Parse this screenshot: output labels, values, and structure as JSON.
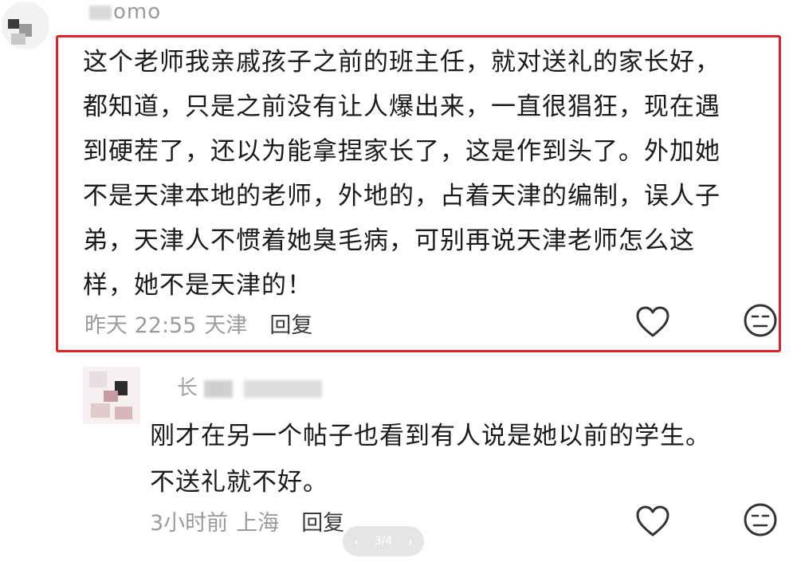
{
  "top_comment": {
    "username_visible": "omo",
    "lines": [
      "这个老师我亲戚孩子之前的班主任，就对送礼的家长好，",
      "都知道，只是之前没有让人爆出来，一直很猖狂，现在遇",
      "到硬茬了，还以为能拿捏家长了，这是作到头了。外加她",
      "不是天津本地的老师，外地的，占着天津的编制，误人子",
      "弟，天津人不惯着她臭毛病，可别再说天津老师怎么这",
      "样，她不是天津的！"
    ],
    "time": "昨天 22:55",
    "location": "天津",
    "reply_label": "回复",
    "like_icon": "heart-outline-icon",
    "emoji_icon": "meh-face-icon",
    "highlight_color": "#e0232a"
  },
  "reply_comment": {
    "username_visible": "长",
    "lines": [
      "刚才在另一个帖子也看到有人说是她以前的学生。",
      "不送礼就不好。"
    ],
    "time": "3小时前",
    "location": "上海",
    "reply_label": "回复",
    "like_icon": "heart-outline-icon",
    "emoji_icon": "meh-face-icon"
  },
  "pager": {
    "prev": "‹",
    "label": "3/4",
    "next": "›"
  }
}
